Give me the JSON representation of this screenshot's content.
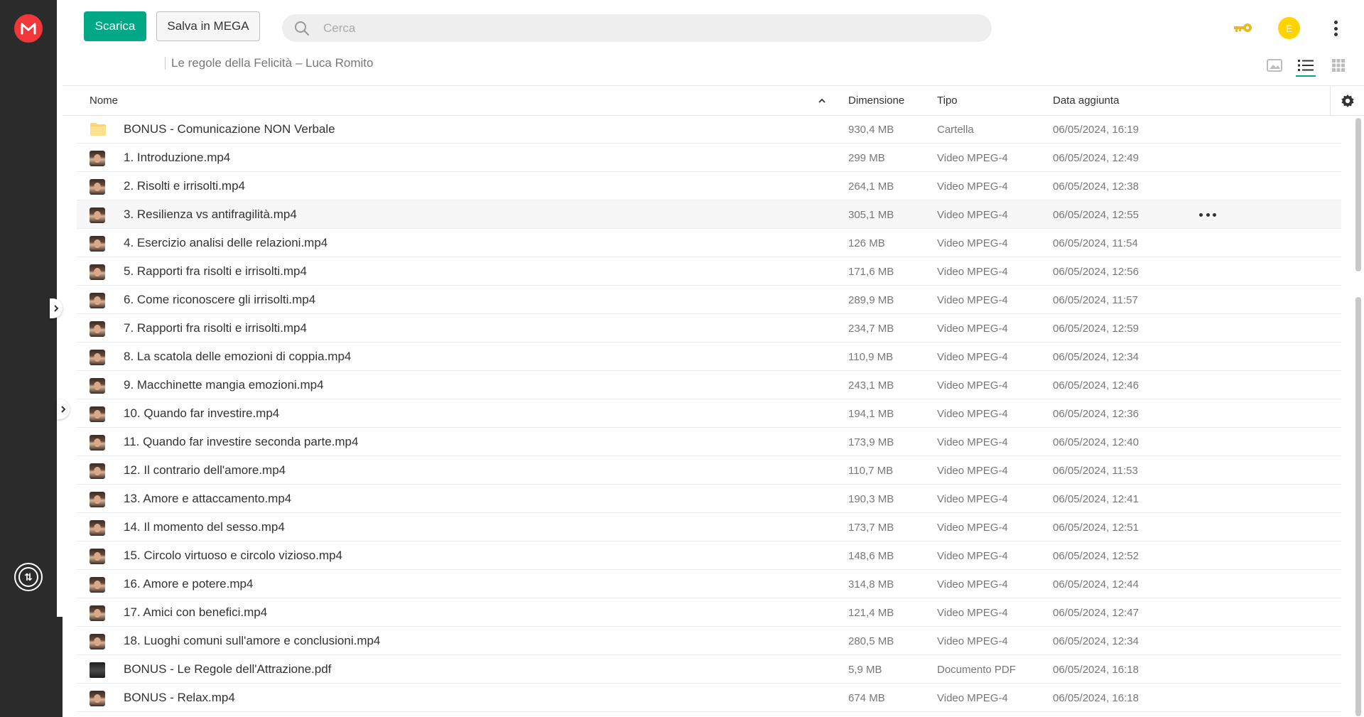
{
  "toolbar": {
    "download_label": "Scarica",
    "save_label": "Salva in MEGA"
  },
  "search": {
    "placeholder": "Cerca",
    "value": ""
  },
  "user": {
    "avatar_initial": "E"
  },
  "breadcrumb": {
    "current": "Le regole della Felicità – Luca Romito"
  },
  "columns": {
    "name": "Nome",
    "size": "Dimensione",
    "type": "Tipo",
    "date": "Data aggiunta"
  },
  "files": [
    {
      "name": "BONUS - Comunicazione NON Verbale",
      "size": "930,4 MB",
      "type": "Cartella",
      "date": "06/05/2024, 16:19",
      "icon": "folder-icon"
    },
    {
      "name": "1. Introduzione.mp4",
      "size": "299 MB",
      "type": "Video MPEG-4",
      "date": "06/05/2024, 12:49",
      "icon": "video-thumbnail"
    },
    {
      "name": "2. Risolti e irrisolti.mp4",
      "size": "264,1 MB",
      "type": "Video MPEG-4",
      "date": "06/05/2024, 12:38",
      "icon": "video-thumbnail"
    },
    {
      "name": "3. Resilienza vs antifragilità.mp4",
      "size": "305,1 MB",
      "type": "Video MPEG-4",
      "date": "06/05/2024, 12:55",
      "icon": "video-thumbnail"
    },
    {
      "name": "4. Esercizio analisi delle relazioni.mp4",
      "size": "126 MB",
      "type": "Video MPEG-4",
      "date": "06/05/2024, 11:54",
      "icon": "video-thumbnail"
    },
    {
      "name": "5. Rapporti fra risolti e irrisolti.mp4",
      "size": "171,6 MB",
      "type": "Video MPEG-4",
      "date": "06/05/2024, 12:56",
      "icon": "video-thumbnail"
    },
    {
      "name": "6. Come riconoscere gli irrisolti.mp4",
      "size": "289,9 MB",
      "type": "Video MPEG-4",
      "date": "06/05/2024, 11:57",
      "icon": "video-thumbnail"
    },
    {
      "name": "7. Rapporti fra risolti e irrisolti.mp4",
      "size": "234,7 MB",
      "type": "Video MPEG-4",
      "date": "06/05/2024, 12:59",
      "icon": "video-thumbnail"
    },
    {
      "name": "8. La scatola delle emozioni di coppia.mp4",
      "size": "110,9 MB",
      "type": "Video MPEG-4",
      "date": "06/05/2024, 12:34",
      "icon": "video-thumbnail"
    },
    {
      "name": "9. Macchinette mangia emozioni.mp4",
      "size": "243,1 MB",
      "type": "Video MPEG-4",
      "date": "06/05/2024, 12:46",
      "icon": "video-thumbnail"
    },
    {
      "name": "10. Quando far investire.mp4",
      "size": "194,1 MB",
      "type": "Video MPEG-4",
      "date": "06/05/2024, 12:36",
      "icon": "video-thumbnail"
    },
    {
      "name": "11. Quando far investire seconda parte.mp4",
      "size": "173,9 MB",
      "type": "Video MPEG-4",
      "date": "06/05/2024, 12:40",
      "icon": "video-thumbnail"
    },
    {
      "name": "12. Il contrario dell'amore.mp4",
      "size": "110,7 MB",
      "type": "Video MPEG-4",
      "date": "06/05/2024, 11:53",
      "icon": "video-thumbnail"
    },
    {
      "name": "13. Amore e attaccamento.mp4",
      "size": "190,3 MB",
      "type": "Video MPEG-4",
      "date": "06/05/2024, 12:41",
      "icon": "video-thumbnail"
    },
    {
      "name": "14. Il momento del sesso.mp4",
      "size": "173,7 MB",
      "type": "Video MPEG-4",
      "date": "06/05/2024, 12:51",
      "icon": "video-thumbnail"
    },
    {
      "name": "15. Circolo virtuoso e circolo vizioso.mp4",
      "size": "148,6 MB",
      "type": "Video MPEG-4",
      "date": "06/05/2024, 12:52",
      "icon": "video-thumbnail"
    },
    {
      "name": "16. Amore e potere.mp4",
      "size": "314,8 MB",
      "type": "Video MPEG-4",
      "date": "06/05/2024, 12:44",
      "icon": "video-thumbnail"
    },
    {
      "name": "17. Amici con benefici.mp4",
      "size": "121,4 MB",
      "type": "Video MPEG-4",
      "date": "06/05/2024, 12:47",
      "icon": "video-thumbnail"
    },
    {
      "name": "18. Luoghi comuni sull'amore e conclusioni.mp4",
      "size": "280,5 MB",
      "type": "Video MPEG-4",
      "date": "06/05/2024, 12:34",
      "icon": "video-thumbnail"
    },
    {
      "name": "BONUS - Le Regole dell'Attrazione.pdf",
      "size": "5,9 MB",
      "type": "Documento PDF",
      "date": "06/05/2024, 16:18",
      "icon": "pdf-thumbnail"
    },
    {
      "name": "BONUS - Relax.mp4",
      "size": "674 MB",
      "type": "Video MPEG-4",
      "date": "06/05/2024, 16:18",
      "icon": "video-thumbnail"
    }
  ],
  "hovered_row_index": 3,
  "colors": {
    "accent": "#00a886",
    "brand": "#f0373a",
    "avatar": "#ffd300",
    "key": "#e8b925",
    "rail": "#2b2b2b"
  }
}
